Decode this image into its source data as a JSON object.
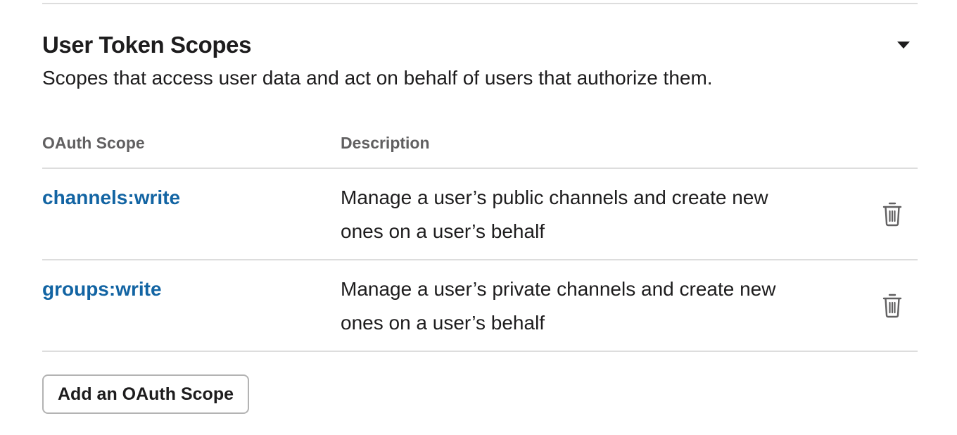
{
  "section": {
    "title": "User Token Scopes",
    "description": "Scopes that access user data and act on behalf of users that authorize them.",
    "toggle_icon": "caret-down-icon"
  },
  "table": {
    "columns": {
      "scope": "OAuth Scope",
      "description": "Description"
    },
    "rows": [
      {
        "scope": "channels:write",
        "description": "Manage a user’s public channels and create new ones on a user’s behalf",
        "action_icon": "trash-icon"
      },
      {
        "scope": "groups:write",
        "description": "Manage a user’s private channels and create new ones on a user’s behalf",
        "action_icon": "trash-icon"
      }
    ]
  },
  "actions": {
    "add_scope_label": "Add an OAuth Scope"
  },
  "colors": {
    "link": "#1264a3",
    "text": "#1d1c1d",
    "muted": "#616061",
    "divider": "#dddddd"
  }
}
